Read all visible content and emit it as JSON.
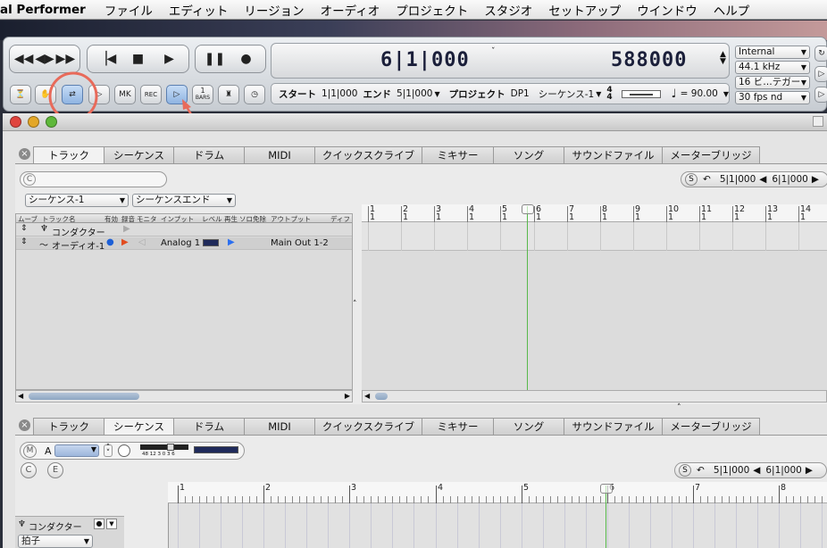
{
  "menubar": {
    "app": "al Performer",
    "items": [
      "ファイル",
      "エディット",
      "リージョン",
      "オーディオ",
      "プロジェクト",
      "スタジオ",
      "セットアップ",
      "ウインドウ",
      "ヘルプ"
    ]
  },
  "control": {
    "counter_main": "6|1|000",
    "counter_samples": "588000",
    "info": {
      "start_label": "スタート",
      "start": "1|1|000",
      "end_label": "エンド",
      "end": "5|1|000",
      "project_label": "プロジェクト",
      "project": "DP1",
      "sequence": "シーケンス-1",
      "meter_top": "4",
      "meter_bottom": "4",
      "tempo_eq": "= 90.00"
    },
    "sync": "Internal",
    "rate": "44.1 kHz",
    "bits": "16 ビ…テガー",
    "fps": "30 fps nd",
    "bars_top": "1",
    "bars_bottom": "BARS",
    "rec_label": "REC",
    "highlight_color": "#e86a5a"
  },
  "top": {
    "tabs": [
      "トラック",
      "シーケンス",
      "ドラム",
      "MIDI",
      "クイックスクライブ",
      "ミキサー",
      "ソング",
      "サウンドファイル",
      "メーターブリッジ"
    ],
    "active_tab": 0,
    "chunk_menu": "シーケンス-1",
    "end_menu": "シーケンスエンド",
    "c_label": "C",
    "s_label": "S",
    "nav_start": "5|1|000",
    "nav_end": "6|1|000",
    "columns": [
      "ムーブ",
      "トラック名",
      "有効",
      "録音",
      "モニタ",
      "インプット",
      "レベル",
      "再生",
      "ソロ",
      "免除",
      "アウトプット",
      "ディフ"
    ],
    "tracks": [
      {
        "name": "コンダクター",
        "input": "",
        "output": ""
      },
      {
        "name": "オーディオ-1",
        "input": "Analog 1",
        "output": "Main Out 1-2"
      }
    ],
    "ruler": [
      {
        "bar": "1",
        "beat": "1"
      },
      {
        "bar": "2",
        "beat": "1"
      },
      {
        "bar": "3",
        "beat": "1"
      },
      {
        "bar": "4",
        "beat": "1"
      },
      {
        "bar": "5",
        "beat": "1"
      },
      {
        "bar": "6",
        "beat": "1"
      },
      {
        "bar": "7",
        "beat": "1"
      },
      {
        "bar": "8",
        "beat": "1"
      },
      {
        "bar": "9",
        "beat": "1"
      },
      {
        "bar": "10",
        "beat": "1"
      },
      {
        "bar": "11",
        "beat": "1"
      },
      {
        "bar": "12",
        "beat": "1"
      },
      {
        "bar": "13",
        "beat": "1"
      },
      {
        "bar": "14",
        "beat": "1"
      }
    ]
  },
  "bottom": {
    "tabs": [
      "トラック",
      "シーケンス",
      "ドラム",
      "MIDI",
      "クイックスクライブ",
      "ミキサー",
      "ソング",
      "サウンドファイル",
      "メーターブリッジ"
    ],
    "active_tab": 1,
    "m_label": "M",
    "a_label": "A",
    "c_label": "C",
    "e_label": "E",
    "s_label": "S",
    "meter_scale": "48 12 3 0 3 6",
    "nav_start": "5|1|000",
    "nav_end": "6|1|000",
    "ruler": [
      "1",
      "2",
      "3",
      "4",
      "5",
      "6",
      "7",
      "8"
    ],
    "track_name": "コンダクター",
    "lane_menu": "拍子"
  }
}
